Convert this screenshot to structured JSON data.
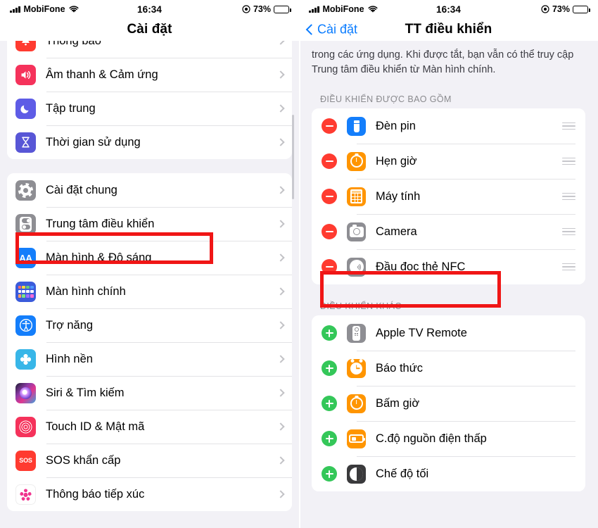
{
  "statusbar": {
    "carrier": "MobiFone",
    "time": "16:34",
    "battery_pct": "73%",
    "signal_icon": "cellular-bars-icon",
    "wifi_icon": "wifi-icon",
    "location_icon": "location-arrow-icon",
    "battery_icon": "battery-charging-icon"
  },
  "left_panel": {
    "nav_title": "Cài đặt",
    "group1": [
      {
        "label": "Thông báo",
        "icon": "bell-icon"
      },
      {
        "label": "Âm thanh & Cảm ứng",
        "icon": "speaker-icon"
      },
      {
        "label": "Tập trung",
        "icon": "moon-icon"
      },
      {
        "label": "Thời gian sử dụng",
        "icon": "hourglass-icon"
      }
    ],
    "group2": [
      {
        "label": "Cài đặt chung",
        "icon": "gear-icon"
      },
      {
        "label": "Trung tâm điều khiển",
        "icon": "control-center-icon"
      },
      {
        "label": "Màn hình & Độ sáng",
        "icon": "aa-text-icon"
      },
      {
        "label": "Màn hình chính",
        "icon": "home-screen-icon"
      },
      {
        "label": "Trợ năng",
        "icon": "accessibility-icon"
      },
      {
        "label": "Hình nền",
        "icon": "wallpaper-icon"
      },
      {
        "label": "Siri & Tìm kiếm",
        "icon": "siri-icon"
      },
      {
        "label": "Touch ID & Mật mã",
        "icon": "fingerprint-icon"
      },
      {
        "label": "SOS khẩn cấp",
        "icon": "sos-icon"
      },
      {
        "label": "Thông báo tiếp xúc",
        "icon": "exposure-notification-icon"
      }
    ]
  },
  "right_panel": {
    "back_label": "Cài đặt",
    "nav_title": "TT điều khiển",
    "description": "trong các ứng dụng. Khi được tắt, bạn vẫn có thể truy cập Trung tâm điều khiển từ Màn hình chính.",
    "section_included": "ĐIỀU KHIỂN ĐƯỢC BAO GỒM",
    "section_other": "ĐIỀU KHIỂN KHÁC",
    "included": [
      {
        "label": "Đèn pin",
        "icon": "flashlight-icon",
        "action": "remove",
        "handle": "reorder-handle-icon"
      },
      {
        "label": "Hẹn giờ",
        "icon": "timer-icon",
        "action": "remove",
        "handle": "reorder-handle-icon"
      },
      {
        "label": "Máy tính",
        "icon": "calculator-icon",
        "action": "remove",
        "handle": "reorder-handle-icon"
      },
      {
        "label": "Camera",
        "icon": "camera-icon",
        "action": "remove",
        "handle": "reorder-handle-icon"
      },
      {
        "label": "Đầu đọc thẻ NFC",
        "icon": "nfc-icon",
        "action": "remove",
        "handle": "reorder-handle-icon"
      }
    ],
    "other": [
      {
        "label": "Apple TV Remote",
        "icon": "tv-remote-icon",
        "action": "add"
      },
      {
        "label": "Báo thức",
        "icon": "alarm-clock-icon",
        "action": "add"
      },
      {
        "label": "Bấm giờ",
        "icon": "stopwatch-icon",
        "action": "add"
      },
      {
        "label": "C.độ nguồn điện thấp",
        "icon": "low-power-battery-icon",
        "action": "add"
      },
      {
        "label": "Chế độ tối",
        "icon": "dark-mode-icon",
        "action": "add"
      }
    ]
  },
  "annotations": {
    "highlight_color": "#f01616",
    "left_target": "Trung tâm điều khiển",
    "right_target": "Đầu đọc thẻ NFC"
  },
  "theme": {
    "accent_blue": "#0a7cff",
    "page_bg": "#f2f1f6",
    "card_bg": "#ffffff",
    "remove_red": "#ff3b30",
    "add_green": "#34c759"
  }
}
